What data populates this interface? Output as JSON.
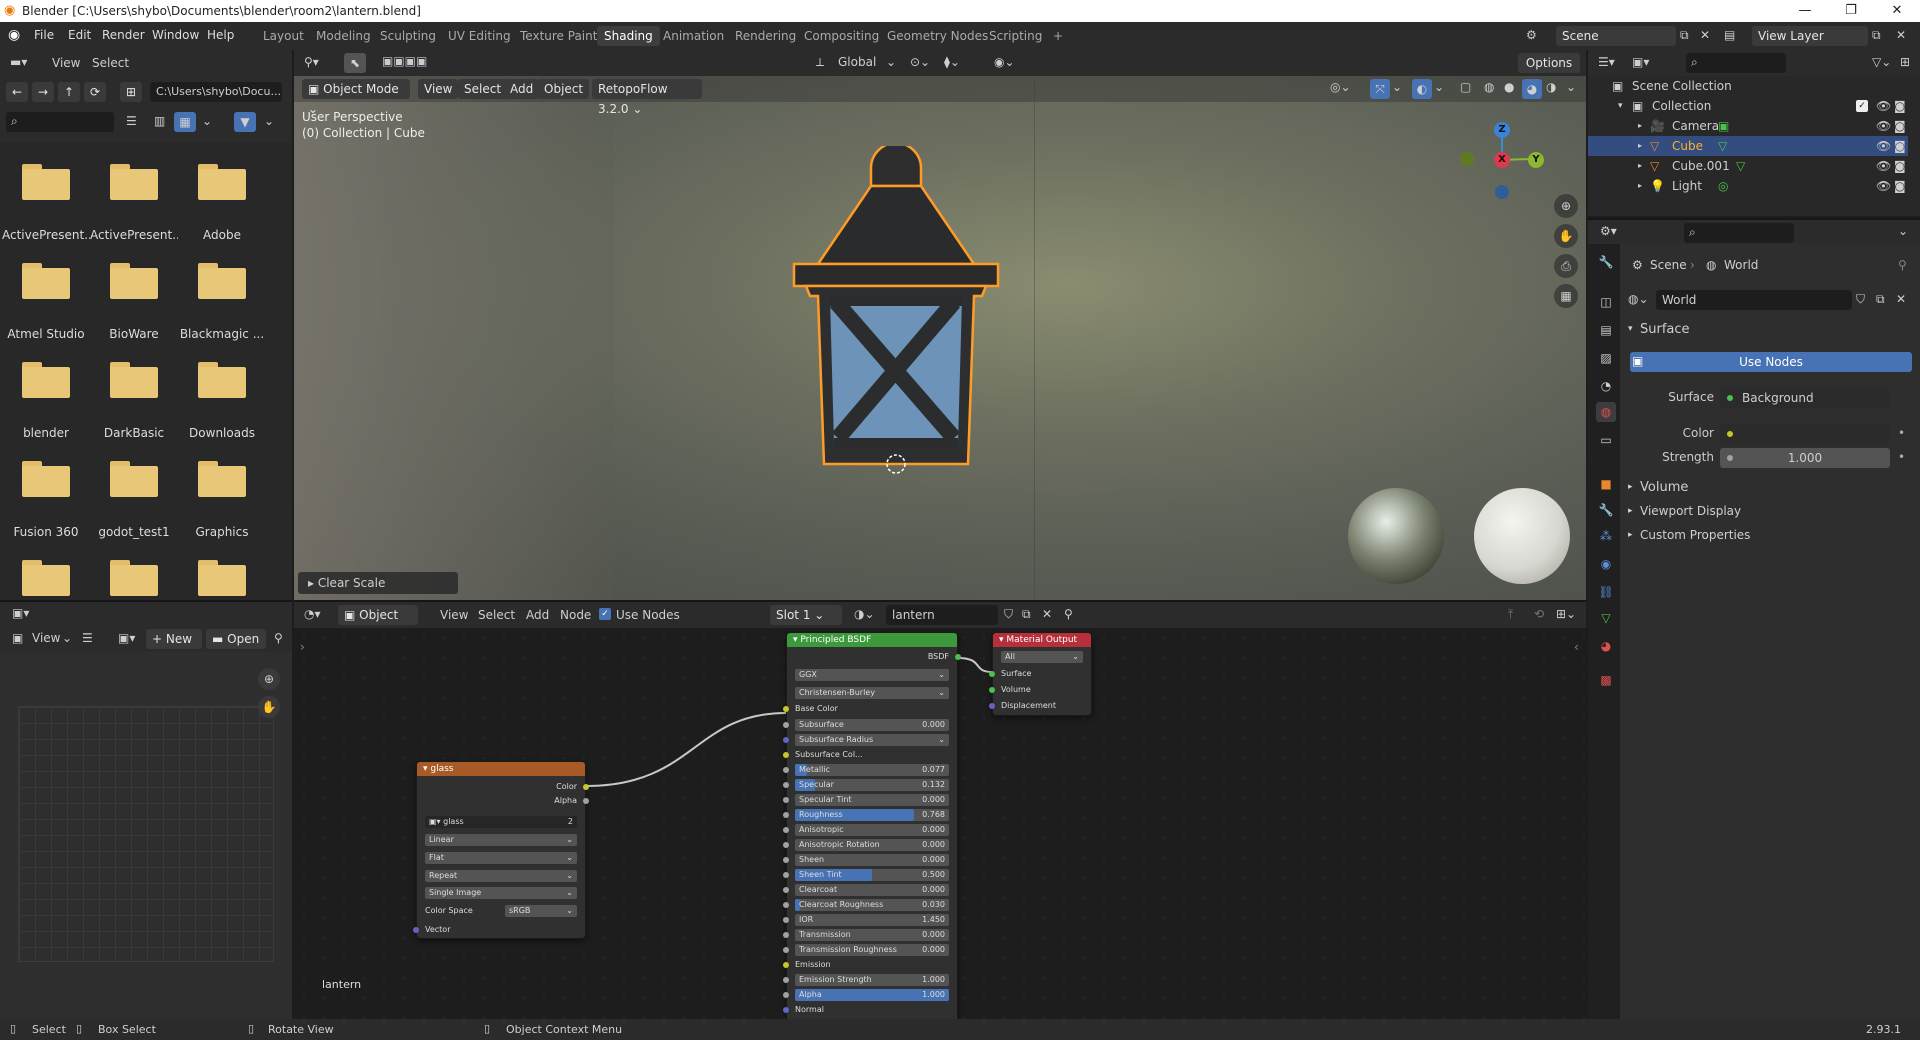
{
  "window": {
    "title": "Blender [C:\\Users\\shybo\\Documents\\blender\\room2\\lantern.blend]",
    "min": "—",
    "max": "❐",
    "close": "✕"
  },
  "menu": [
    "File",
    "Edit",
    "Render",
    "Window",
    "Help"
  ],
  "workspaces": [
    "Layout",
    "Modeling",
    "Sculpting",
    "UV Editing",
    "Texture Paint",
    "Shading",
    "Animation",
    "Rendering",
    "Compositing",
    "Geometry Nodes",
    "Scripting",
    "+"
  ],
  "scene": {
    "name": "Scene",
    "view_layer": "View Layer"
  },
  "filebrowser": {
    "view": "View",
    "select": "Select",
    "path": "C:\\Users\\shybo\\Docu...",
    "search_placeholder": "",
    "folders": [
      "ActivePresent...",
      "ActivePresent...",
      "Adobe",
      "Atmel Studio",
      "BioWare",
      "Blackmagic ...",
      "blender",
      "DarkBasic",
      "Downloads",
      "Fusion 360",
      "godot_test1",
      "Graphics",
      "",
      "",
      ""
    ]
  },
  "image_editor": {
    "view": "View",
    "new": "New",
    "open": "Open"
  },
  "viewport": {
    "mode": "Object Mode",
    "view": "View",
    "select": "Select",
    "add": "Add",
    "object": "Object",
    "addon": "RetopoFlow 3.2.0",
    "orientation": "Global",
    "options": "Options",
    "info1": "User Perspective",
    "info2": "(0) Collection | Cube",
    "redo_panel": "Clear Scale",
    "axes": {
      "x": "X",
      "y": "Y",
      "z": "Z"
    }
  },
  "node_editor": {
    "type": "Object",
    "view": "View",
    "select": "Select",
    "add": "Add",
    "node": "Node",
    "use_nodes": "Use Nodes",
    "slot": "Slot 1",
    "material": "lantern",
    "material_label": "lantern",
    "image_node": {
      "title": "glass",
      "out_color": "Color",
      "out_alpha": "Alpha",
      "image": "glass",
      "users": "2",
      "interp": "Linear",
      "proj": "Flat",
      "ext": "Repeat",
      "source": "Single Image",
      "cs_label": "Color Space",
      "cs": "sRGB",
      "vector": "Vector"
    },
    "bsdf": {
      "title": "Principled BSDF",
      "out": "BSDF",
      "dist": "GGX",
      "sss": "Christensen-Burley",
      "base_color": "Base Color",
      "fields": [
        {
          "label": "Subsurface",
          "value": "0.000",
          "fill": 0
        },
        {
          "label": "Subsurface Radius",
          "value": "",
          "fill": 0,
          "dropdown": true
        },
        {
          "label": "Subsurface Col...",
          "value": "",
          "fill": 0,
          "color": "#e8e8e8"
        },
        {
          "label": "Metallic",
          "value": "0.077",
          "fill": 0.077
        },
        {
          "label": "Specular",
          "value": "0.132",
          "fill": 0.132
        },
        {
          "label": "Specular Tint",
          "value": "0.000",
          "fill": 0
        },
        {
          "label": "Roughness",
          "value": "0.768",
          "fill": 0.768
        },
        {
          "label": "Anisotropic",
          "value": "0.000",
          "fill": 0
        },
        {
          "label": "Anisotropic Rotation",
          "value": "0.000",
          "fill": 0
        },
        {
          "label": "Sheen",
          "value": "0.000",
          "fill": 0
        },
        {
          "label": "Sheen Tint",
          "value": "0.500",
          "fill": 0.5
        },
        {
          "label": "Clearcoat",
          "value": "0.000",
          "fill": 0
        },
        {
          "label": "Clearcoat Roughness",
          "value": "0.030",
          "fill": 0.03
        },
        {
          "label": "IOR",
          "value": "1.450",
          "fill": 0
        },
        {
          "label": "Transmission",
          "value": "0.000",
          "fill": 0
        },
        {
          "label": "Transmission Roughness",
          "value": "0.000",
          "fill": 0
        },
        {
          "label": "Emission",
          "value": "",
          "fill": 0,
          "color": "#000000"
        },
        {
          "label": "Emission Strength",
          "value": "1.000",
          "fill": 0
        },
        {
          "label": "Alpha",
          "value": "1.000",
          "fill": 1
        },
        {
          "label": "Normal",
          "value": "",
          "fill": 0,
          "plain": true
        }
      ]
    },
    "output": {
      "title": "Material Output",
      "target": "All",
      "surface": "Surface",
      "volume": "Volume",
      "displacement": "Displacement"
    }
  },
  "outliner": {
    "root": "Scene Collection",
    "collection": "Collection",
    "items": [
      {
        "name": "Camera",
        "selected": false
      },
      {
        "name": "Cube",
        "selected": true
      },
      {
        "name": "Cube.001",
        "selected": false
      },
      {
        "name": "Light",
        "selected": false
      }
    ]
  },
  "properties": {
    "crumb_scene": "Scene",
    "crumb_world": "World",
    "world_name": "World",
    "surface_panel": "Surface",
    "use_nodes": "Use Nodes",
    "surface_label": "Surface",
    "surface_value": "Background",
    "color_label": "Color",
    "strength_label": "Strength",
    "strength_value": "1.000",
    "panels": [
      "Volume",
      "Viewport Display",
      "Custom Properties"
    ]
  },
  "statusbar": {
    "select": "Select",
    "box_select": "Box Select",
    "rotate": "Rotate View",
    "context": "Object Context Menu",
    "version": "2.93.1"
  }
}
